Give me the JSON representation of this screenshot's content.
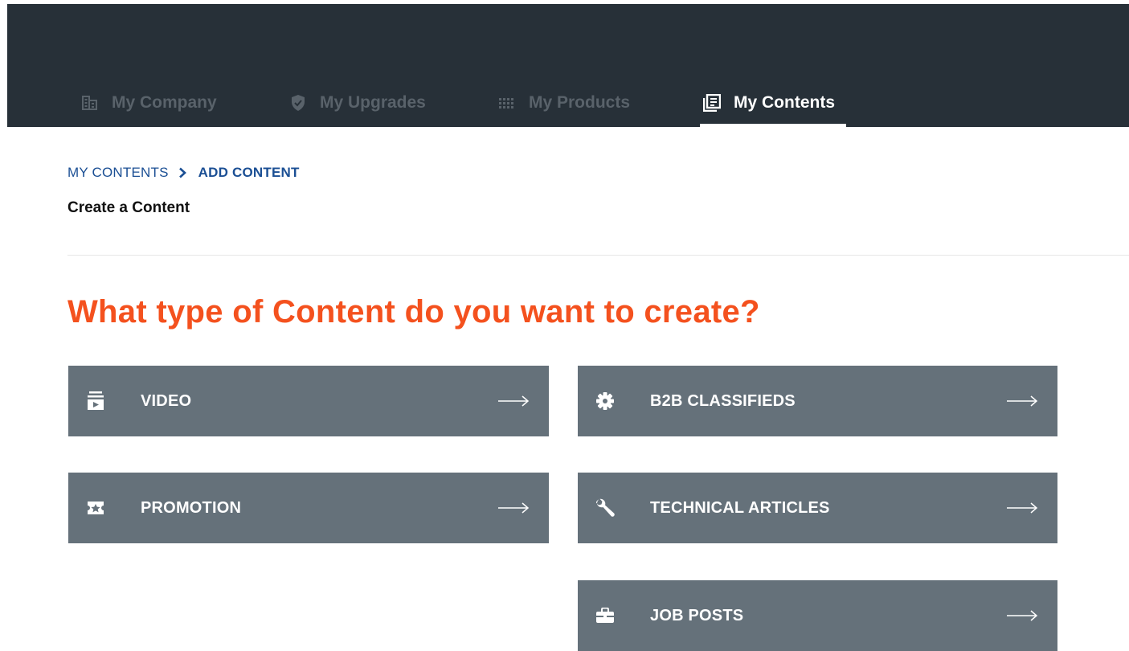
{
  "nav": {
    "tabs": [
      {
        "label": "My Company",
        "icon": "building-icon",
        "active": false
      },
      {
        "label": "My Upgrades",
        "icon": "shield-check-icon",
        "active": false
      },
      {
        "label": "My Products",
        "icon": "grid-icon",
        "active": false
      },
      {
        "label": "My Contents",
        "icon": "content-icon",
        "active": true
      }
    ]
  },
  "breadcrumb": {
    "parent": "MY CONTENTS",
    "current": "ADD CONTENT"
  },
  "page": {
    "subtitle": "Create a Content",
    "heading": "What type of Content do you want to create?"
  },
  "options": [
    {
      "label": "VIDEO",
      "icon": "video-icon"
    },
    {
      "label": "B2B CLASSIFIEDS",
      "icon": "gear-icon"
    },
    {
      "label": "PROMOTION",
      "icon": "promotion-icon"
    },
    {
      "label": "TECHNICAL ARTICLES",
      "icon": "wrench-icon"
    },
    {
      "label": "JOB POSTS",
      "icon": "briefcase-icon"
    }
  ],
  "colors": {
    "topbar": "#273038",
    "tab_inactive": "#59626a",
    "tab_active": "#ffffff",
    "breadcrumb": "#1b4f94",
    "heading": "#f4511e",
    "card": "#65717a"
  }
}
